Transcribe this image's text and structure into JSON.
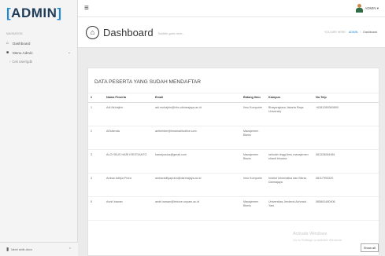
{
  "brand": {
    "open": "[",
    "name": "ADMIN",
    "close": "]"
  },
  "sidebar": {
    "nav_header": "NAVIGATION",
    "items": [
      {
        "icon": "home-icon",
        "label": "Dashboard"
      },
      {
        "icon": "book-icon",
        "label": "Menu Admin"
      },
      {
        "label": "Cek User/gdb"
      }
    ],
    "bottom_label": "label a/db.docx"
  },
  "topbar": {
    "user_label": "ADMIN ▾"
  },
  "page_header": {
    "title": "Dashboard",
    "subtitle": "Subtitle goes here...",
    "breadcrumb_prefix": "YOU ARE HERE:",
    "breadcrumb_link": "ADMIN",
    "breadcrumb_sep": "/",
    "breadcrumb_current": "Dashboard"
  },
  "panel": {
    "title": "DATA PESERTA YANG SUDAH MENDAFTAR",
    "columns": [
      "#",
      "Nama Peserta",
      "Email",
      "Bidang Ilmu",
      "Kampus",
      "No.Telp"
    ],
    "rows": [
      [
        "1",
        "Adi Muhajirin",
        "adi.muhajirin@bhn.ubharajaya.ac.id",
        "Ilmu Komputer",
        "Bhayangkara Jakarta Raya University",
        "+6281285360890"
      ],
      [
        "2",
        "AEstienda",
        "aethehiter@hestmailhotline.com",
        "Manajemen Bisnis",
        "",
        ""
      ],
      [
        "3",
        "ALOYSIUS HARI KRISTIANTO",
        "harialyosius@gmail.com",
        "Manajemen Bisnis",
        "sekolah tinggi ilmu manajemen shanti bhuana",
        "081328084981"
      ],
      [
        "4",
        "Ambar Aditya Putra",
        "ambaradityaputra@darmajaya.ac.id",
        "Ilmu Komputer",
        "Institut Informatika dan Bisnis Darmajaya",
        "08117993320"
      ],
      [
        "5",
        "Andri Irawan",
        "andri.irawan@lecture.unpam.ac.id",
        "Manajemen Bisnis",
        "Universitas Jenderal Achmad Yani",
        "085861480406"
      ]
    ]
  },
  "watermark": {
    "line1": "Activate Windows",
    "line2": "Go to Settings to activate Windows."
  },
  "show_all": "Show all"
}
